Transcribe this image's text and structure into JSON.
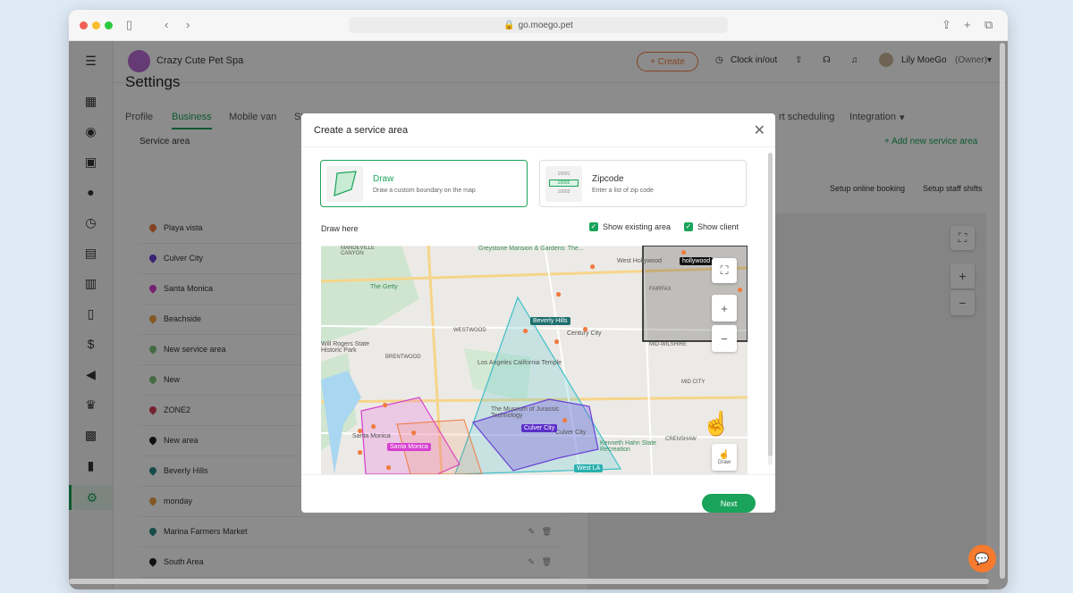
{
  "browser": {
    "url": "go.moego.pet"
  },
  "header": {
    "business_name": "Crazy Cute Pet Spa",
    "create_label": "+ Create",
    "clock_label": "Clock in/out",
    "user_name": "Lily MoeGo",
    "user_role": "(Owner)"
  },
  "page": {
    "title": "Settings",
    "tabs": [
      "Profile",
      "Business",
      "Mobile van",
      "St",
      "rt scheduling",
      "Integration"
    ],
    "section_title": "Service area",
    "add_area_label": "+ Add new service area",
    "setup_booking": "Setup online booking",
    "setup_shifts": "Setup staff shifts"
  },
  "areas": [
    {
      "name": "Playa vista",
      "color": "#f07b3f"
    },
    {
      "name": "Culver City",
      "color": "#6a3fd6"
    },
    {
      "name": "Santa Monica",
      "color": "#d63fd0"
    },
    {
      "name": "Beachside",
      "color": "#f0a03f"
    },
    {
      "name": "New service area",
      "color": "#7cc47c"
    },
    {
      "name": "New",
      "color": "#7cc47c"
    },
    {
      "name": "ZONE2",
      "color": "#d63f5a"
    },
    {
      "name": "New area",
      "color": "#222222"
    },
    {
      "name": "Beverly Hills",
      "color": "#2a8a8a"
    },
    {
      "name": "monday",
      "color": "#f0a03f"
    },
    {
      "name": "Marina Farmers Market",
      "color": "#2a8a8a"
    },
    {
      "name": "South Area",
      "color": "#222222"
    }
  ],
  "modal": {
    "title": "Create a service area",
    "draw": {
      "title": "Draw",
      "subtitle": "Draw a custom boundary on the map"
    },
    "zipcode": {
      "title": "Zipcode",
      "subtitle": "Enter a list of zip code",
      "thumb_codes": [
        "10001",
        "10002",
        "10003"
      ]
    },
    "draw_here": "Draw here",
    "show_existing": "Show existing area",
    "show_client": "Show client",
    "next_label": "Next"
  },
  "map": {
    "labels": [
      "Greystone Mansion & Gardens: The...",
      "West Hollywood",
      "The Getty",
      "FAIRFAX",
      "WESTWOOD",
      "Century City",
      "Los Angeles California Temple",
      "BRENTWOOD",
      "MID-WILSHIRE",
      "Will Rogers State Historic Park",
      "The Museum of Jurassic Technology",
      "Culver City",
      "Kenneth Hahn State Recreation",
      "Santa Monica",
      "CRENSHAW",
      "MID CITY",
      "MANDEVILLE CANYON"
    ],
    "tags": [
      {
        "text": "hollywood",
        "color": "#111111"
      },
      {
        "text": "Beverly Hills",
        "color": "#1d6e6e"
      },
      {
        "text": "Culver City",
        "color": "#5b2fc9"
      },
      {
        "text": "Santa Monica",
        "color": "#d63fd0"
      },
      {
        "text": "West LA",
        "color": "#2ab0b0"
      }
    ],
    "draw_label": "Draw"
  }
}
